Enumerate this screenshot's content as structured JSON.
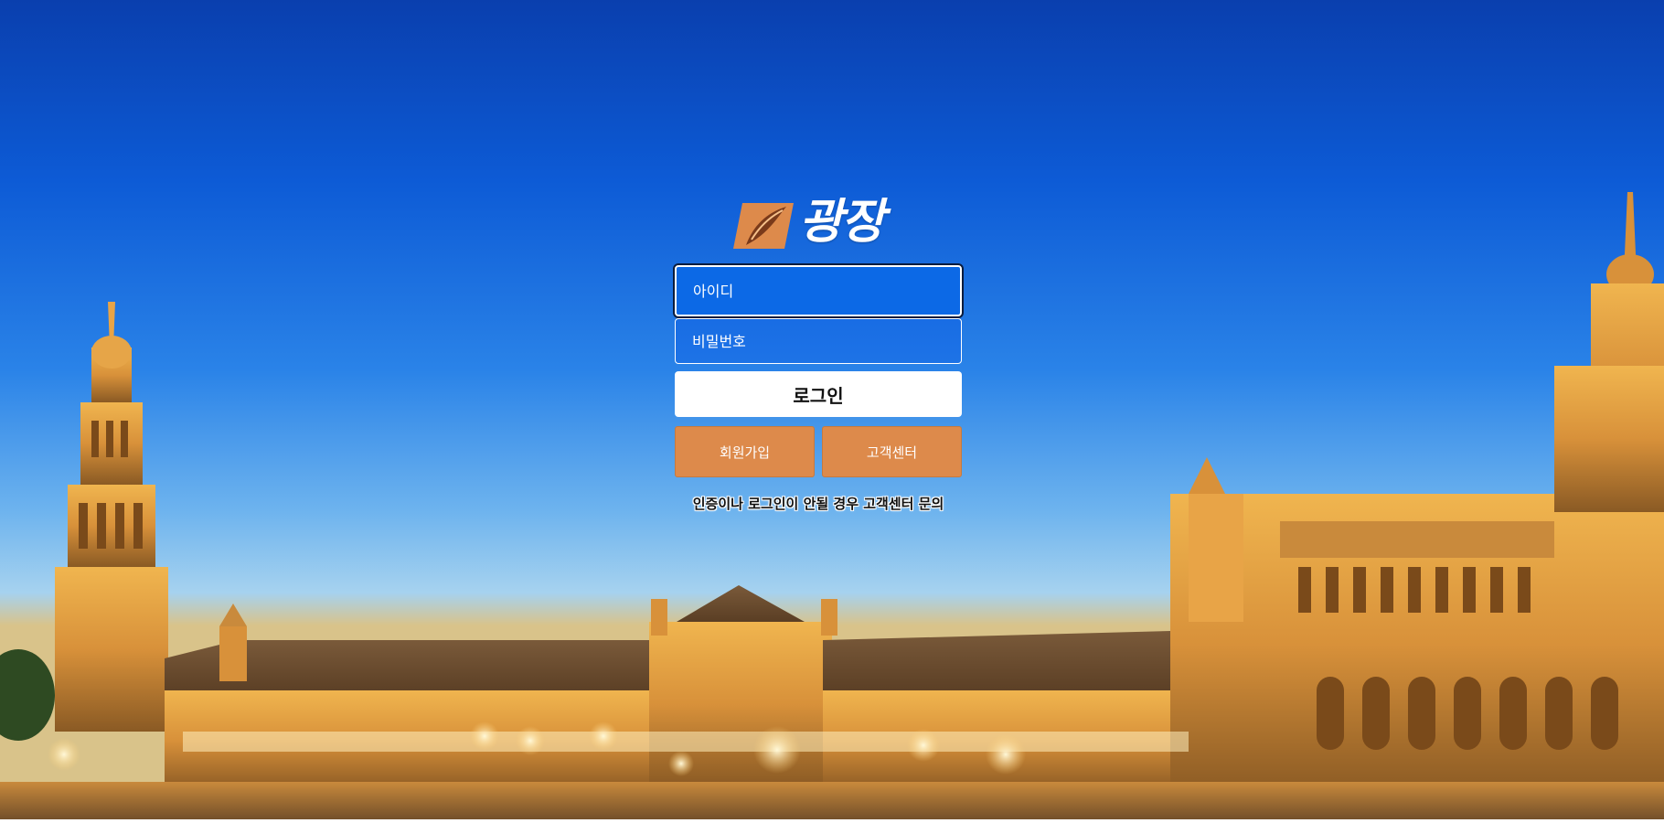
{
  "brand": {
    "logo_text": "광장",
    "logo_color": "#dd8a4b"
  },
  "login_form": {
    "id_placeholder": "아이디",
    "password_placeholder": "비밀번호",
    "login_label": "로그인",
    "signup_label": "회원가입",
    "support_label": "고객센터",
    "notice": "인증이나 로그인이 안될 경우 고객센터 문의"
  },
  "colors": {
    "accent": "#dd8a4b",
    "sky_top": "#0a3fae",
    "sky_bottom": "#a6d2ef",
    "building": "#d99a3c"
  },
  "background": {
    "icon": "plaza-building-photo"
  }
}
